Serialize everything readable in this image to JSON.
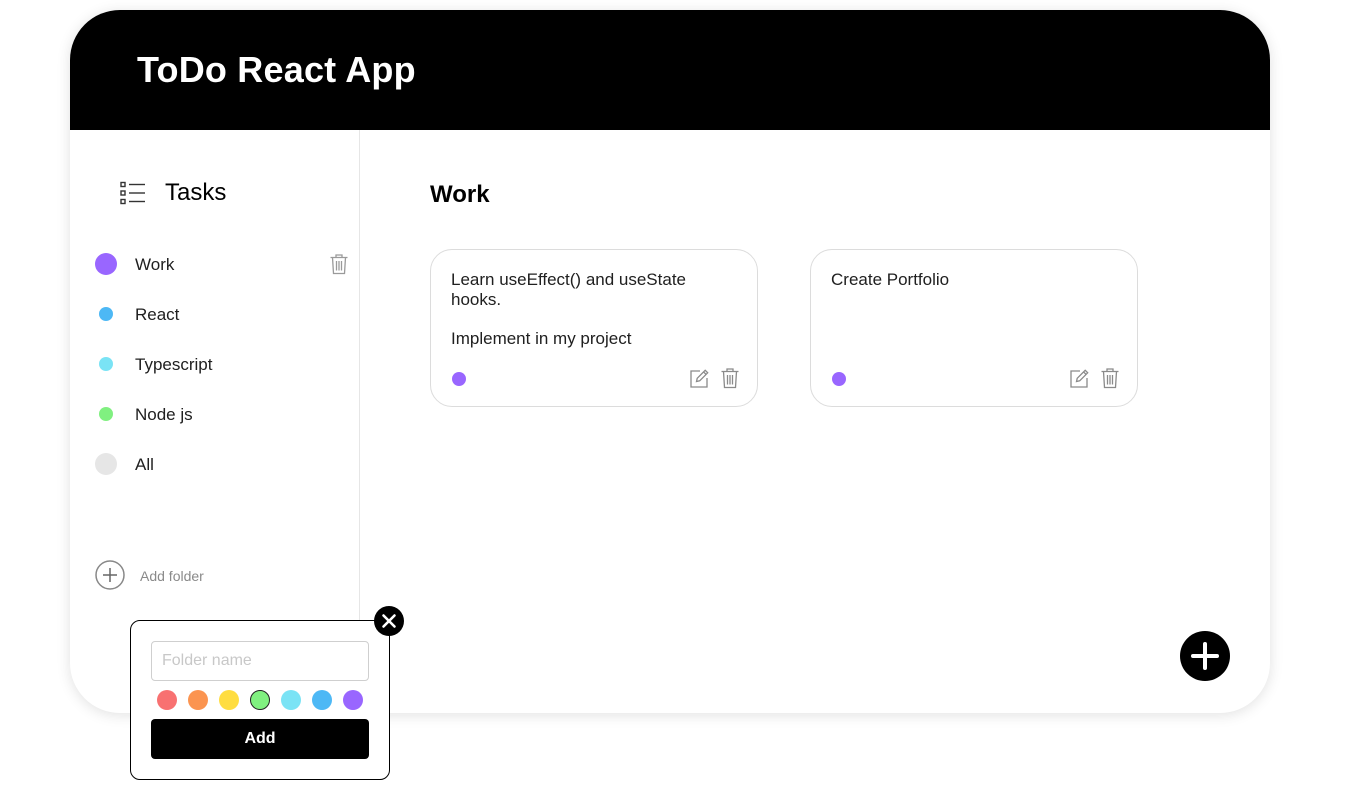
{
  "header": {
    "title": "ToDo React App"
  },
  "sidebar": {
    "title": "Tasks",
    "folders": [
      {
        "label": "Work",
        "color": "#9966ff",
        "active": true
      },
      {
        "label": "React",
        "color": "#4db8f5"
      },
      {
        "label": "Typescript",
        "color": "#7ae3f5"
      },
      {
        "label": "Node js",
        "color": "#80f080"
      },
      {
        "label": "All",
        "color": "#e6e6e6"
      }
    ],
    "add_folder_label": "Add folder"
  },
  "main": {
    "title": "Work",
    "tasks": [
      {
        "lines": [
          "Learn useEffect() and useState hooks.",
          "Implement in my project"
        ],
        "color": "#9966ff"
      },
      {
        "lines": [
          "Create Portfolio"
        ],
        "color": "#9966ff"
      }
    ]
  },
  "popup": {
    "placeholder": "Folder name",
    "value": "",
    "colors": [
      "#f87171",
      "#fb9450",
      "#ffdd40",
      "#80f080",
      "#7ae3f5",
      "#4db8f5",
      "#9966ff"
    ],
    "selected_color": "#80f080",
    "add_label": "Add"
  },
  "icons": {
    "tasks": "list-icon",
    "trash": "trash-icon",
    "edit": "edit-icon",
    "add_folder": "plus-circle-icon",
    "fab": "plus-icon",
    "close": "close-icon"
  }
}
